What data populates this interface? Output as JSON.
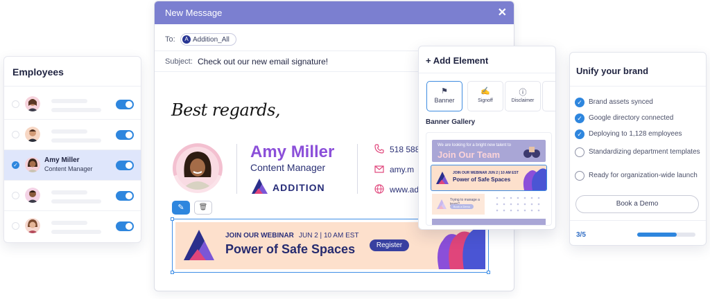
{
  "employees": {
    "title": "Employees",
    "selected": {
      "name": "Amy Miller",
      "role": "Content Manager"
    }
  },
  "compose": {
    "title": "New Message",
    "close_icon": "close-icon",
    "to_label": "To:",
    "to_chip": {
      "initial": "A",
      "text": "Addition_All"
    },
    "subject_label": "Subject:",
    "subject_value": "Check out our new email signature!",
    "signoff": "Best regards,",
    "signature": {
      "name": "Amy Miller",
      "role": "Content Manager",
      "brand": "ADDITION",
      "phone": "518 588",
      "email": "amy.m",
      "web": "www.ad"
    },
    "banner": {
      "kicker": "JOIN OUR WEBINAR",
      "date": "JUN 2 | 10 AM EST",
      "title": "Power of Safe Spaces",
      "button": "Register"
    }
  },
  "add_element": {
    "title": "+ Add Element",
    "options": [
      {
        "label": "Banner",
        "icon": "flag-icon"
      },
      {
        "label": "Signoff",
        "icon": "signature-icon"
      },
      {
        "label": "Disclaimer",
        "icon": "info-icon"
      }
    ],
    "gallery_title": "Banner Gallery",
    "gallery": {
      "g1_small": "We are looking for a bright new talent to",
      "g1_big": "Join Our Team",
      "g2_kicker": "JOIN OUR WEBINAR   JUN 2 | 10 AM EST",
      "g2_title": "Power of Safe Spaces",
      "g3_text": "Trying to manage a team?",
      "g3_button": "Book a Demo"
    }
  },
  "unify": {
    "title": "Unify your brand",
    "tasks": [
      {
        "text": "Brand assets synced",
        "done": true
      },
      {
        "text": "Google directory connected",
        "done": true
      },
      {
        "text": "Deploying to 1,128 employees",
        "done": true
      },
      {
        "text": "Standardizing department templates",
        "done": false
      },
      {
        "text": "Ready for organization-wide launch",
        "done": false
      }
    ],
    "button": "Book a Demo",
    "progress_text": "3/5",
    "progress_value": 0.68
  },
  "colors": {
    "accent": "#2e86de",
    "header": "#7b7fd0",
    "brand_purple": "#8b4fd9",
    "banner_bg": "#fde0cc"
  }
}
